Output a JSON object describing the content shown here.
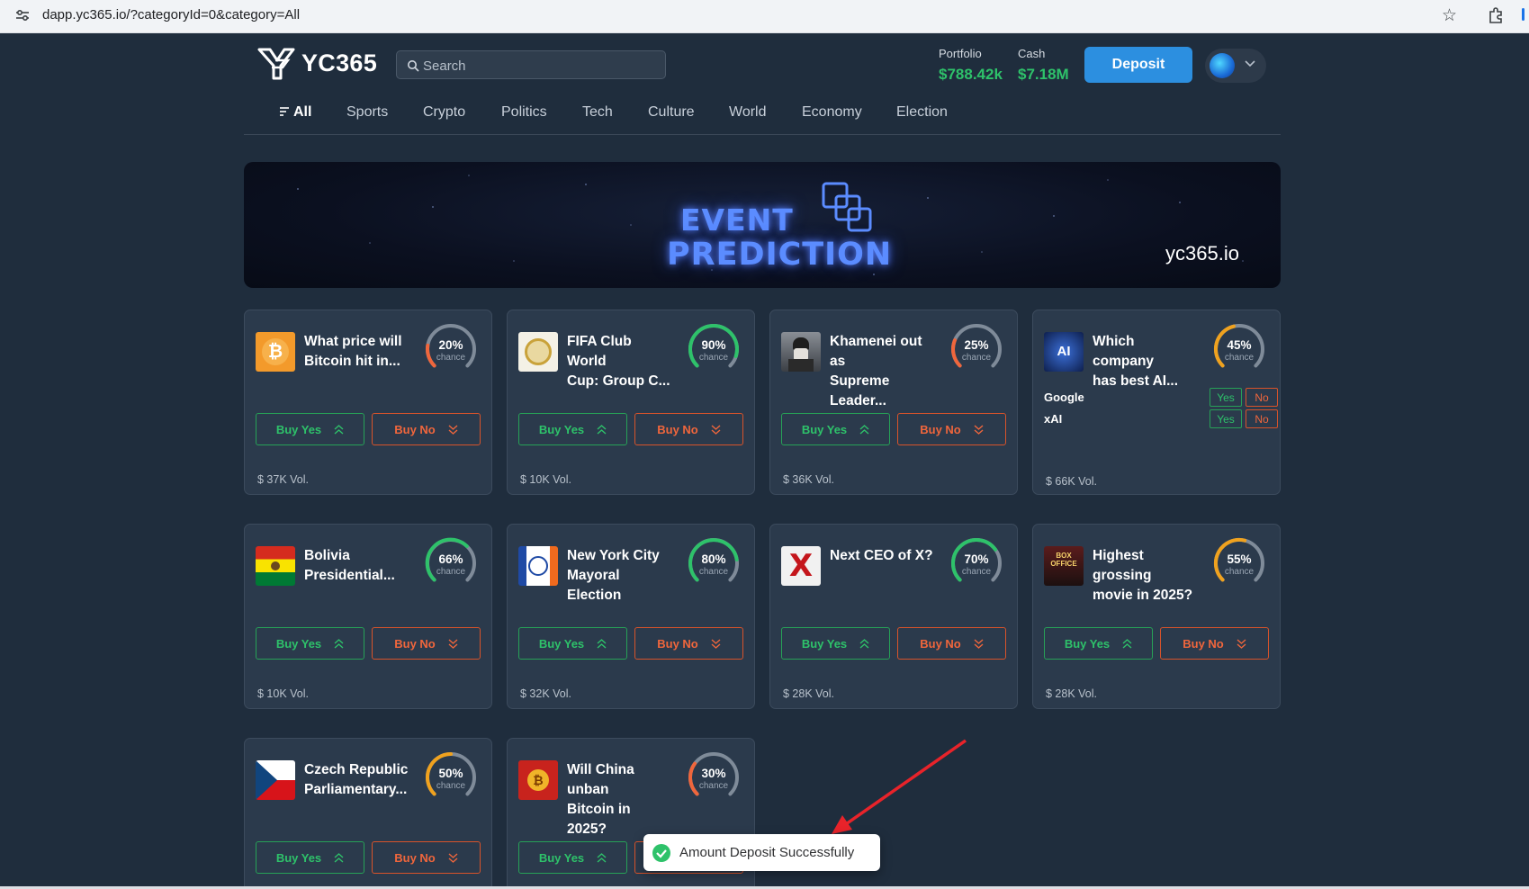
{
  "browser": {
    "url": "dapp.yc365.io/?categoryId=0&category=All"
  },
  "header": {
    "logo_text": "YC365",
    "search_placeholder": "Search",
    "portfolio_label": "Portfolio",
    "portfolio_value": "$788.42k",
    "cash_label": "Cash",
    "cash_value": "$7.18M",
    "deposit_label": "Deposit"
  },
  "tabs": [
    {
      "label": "All",
      "active": true
    },
    {
      "label": "Sports"
    },
    {
      "label": "Crypto"
    },
    {
      "label": "Politics"
    },
    {
      "label": "Tech"
    },
    {
      "label": "Culture"
    },
    {
      "label": "World"
    },
    {
      "label": "Economy"
    },
    {
      "label": "Election"
    }
  ],
  "banner": {
    "line1": "EVENT",
    "line2": "PREDICTION",
    "site": "yc365.io"
  },
  "labels": {
    "buy_yes": "Buy Yes",
    "buy_no": "Buy No",
    "chance": "chance",
    "yes": "Yes",
    "no": "No"
  },
  "colors": {
    "yes": "#2ec26a",
    "no": "#f0663c",
    "accent": "#2c8fe0",
    "page_bg": "#1f2d3d",
    "card_bg": "#2b3a4c"
  },
  "cards": [
    {
      "title_1": "What price will",
      "title_2": "Bitcoin hit in...",
      "chance": 20,
      "chance_text": "20%",
      "vol": "$ 37K Vol.",
      "icon": "bitcoin-icon"
    },
    {
      "title_1": "FIFA Club World",
      "title_2": "Cup: Group C...",
      "chance": 90,
      "chance_text": "90%",
      "vol": "$ 10K Vol.",
      "icon": "fifa-emblem-icon"
    },
    {
      "title_1": "Khamenei out as",
      "title_2": "Supreme Leader...",
      "chance": 25,
      "chance_text": "25%",
      "vol": "$ 36K Vol.",
      "icon": "khamenei-portrait-icon"
    },
    {
      "title_1": "Which company",
      "title_2": "has best AI...",
      "chance": 45,
      "chance_text": "45%",
      "vol": "$ 66K Vol.",
      "icon": "ai-icon",
      "options": [
        {
          "name": "Google"
        },
        {
          "name": "xAI"
        }
      ]
    },
    {
      "title_1": "Bolivia",
      "title_2": "Presidential...",
      "chance": 66,
      "chance_text": "66%",
      "vol": "$ 10K Vol.",
      "icon": "bolivia-flag-icon"
    },
    {
      "title_1": "New York City",
      "title_2": "Mayoral Election",
      "chance": 80,
      "chance_text": "80%",
      "vol": "$ 32K Vol.",
      "icon": "nyc-seal-icon"
    },
    {
      "title_1": "Next CEO of X?",
      "title_2": "",
      "chance": 70,
      "chance_text": "70%",
      "vol": "$ 28K Vol.",
      "icon": "x-logo-icon"
    },
    {
      "title_1": "Highest grossing",
      "title_2": "movie in 2025?",
      "chance": 55,
      "chance_text": "55%",
      "vol": "$ 28K Vol.",
      "icon": "box-office-icon"
    },
    {
      "title_1": "Czech Republic",
      "title_2": "Parliamentary...",
      "chance": 50,
      "chance_text": "50%",
      "vol": "",
      "icon": "czech-flag-icon"
    },
    {
      "title_1": "Will China unban",
      "title_2": "Bitcoin in 2025?",
      "chance": 30,
      "chance_text": "30%",
      "vol": "",
      "icon": "china-bitcoin-icon"
    }
  ],
  "toast": {
    "message": "Amount Deposit Successfully"
  }
}
